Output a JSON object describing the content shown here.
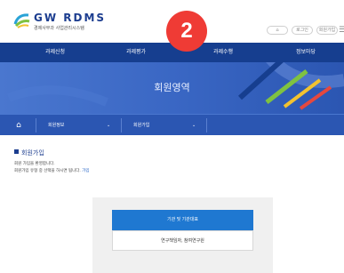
{
  "header": {
    "logo_text": "GW RDMS",
    "logo_sub": "경제사무과 사업관리시스템",
    "util": {
      "home": "⌂",
      "login": "로그인",
      "join": "회원가입"
    },
    "menu_icon": "☰"
  },
  "badge": "2",
  "nav": {
    "items": [
      "과제신청",
      "과제평가",
      "과제수행",
      "정보마당"
    ]
  },
  "banner": {
    "title": "회원영역",
    "colors": {
      "bg": "#3a67c4",
      "accent_green": "#7fc241",
      "accent_yellow": "#f2c230",
      "accent_red": "#e5483e"
    }
  },
  "subnav": {
    "home_icon": "⌂",
    "items": [
      "회원정보",
      "회원가입"
    ],
    "chevron": "⌄"
  },
  "section": {
    "title": "회원가입",
    "desc1": "회원 가입을 환영합니다.",
    "desc2": "회원가입 유형 중 선택을 하시면 됩니다.",
    "desc2_link": "가입"
  },
  "buttons": {
    "primary": "기관 및 기관대표",
    "secondary": "연구책임자, 참여연구원"
  },
  "colors": {
    "nav": "#163e8f",
    "primary_button": "#1f78d1",
    "badge": "#ef3b35"
  }
}
